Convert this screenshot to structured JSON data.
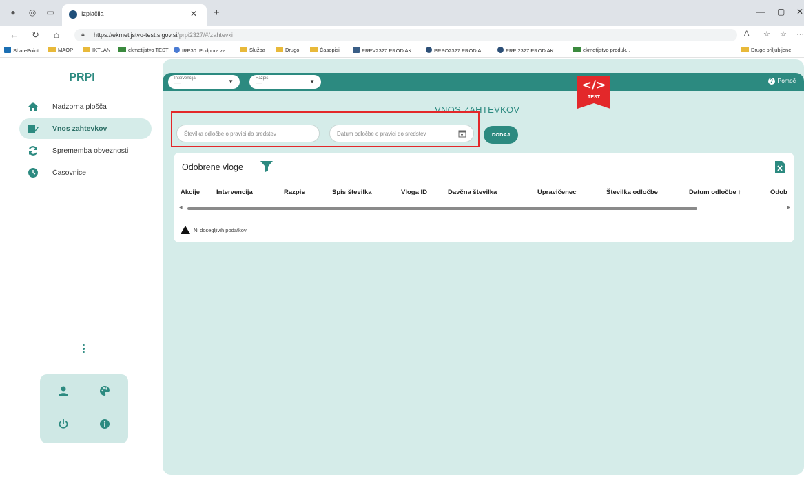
{
  "browser": {
    "tab_title": "Izplačila",
    "url_host": "https://ekmetijstvo-test.sigov.si",
    "url_path": "/prpi2327/#/zahtevki",
    "bookmarks": [
      "SharePoint",
      "MAOP",
      "IXTLAN",
      "ekmetijstvo TEST",
      "IRP30: Podpora za...",
      "Služba",
      "Drugo",
      "Časopisi",
      "PRPV2327 PROD AK...",
      "PRPO2327 PROD A...",
      "PRPI2327 PROD AK...",
      "ekmetijstvo produk..."
    ],
    "other_bookmarks": "Druge priljubljene"
  },
  "sidebar": {
    "brand": "PRPI",
    "items": [
      {
        "label": "Nadzorna plošča",
        "icon": "home-icon"
      },
      {
        "label": "Vnos zahtevkov",
        "icon": "edit-document-icon"
      },
      {
        "label": "Sprememba obveznosti",
        "icon": "refresh-icon"
      },
      {
        "label": "Časovnice",
        "icon": "clock-icon"
      }
    ],
    "utility_icons": [
      "user-icon",
      "palette-icon",
      "power-icon",
      "info-icon"
    ]
  },
  "topbar": {
    "intervencija_label": "Intervencija",
    "razpis_label": "Razpis",
    "help_label": "Pomoč",
    "env_badge": "TEST",
    "env_symbol": "</>"
  },
  "main": {
    "title": "VNOS ZAHTEVKOV",
    "decision_number_placeholder": "Številka odločbe o pravici do sredstev",
    "decision_date_placeholder": "Datum odločbe o pravici do sredstev",
    "add_button": "DODAJ",
    "table": {
      "title": "Odobrene vloge",
      "columns": [
        "Akcije",
        "Intervencija",
        "Razpis",
        "Spis številka",
        "Vloga ID",
        "Davčna številka",
        "Upravičenec",
        "Številka odločbe",
        "Datum odločbe ↑",
        "Odob"
      ],
      "empty_message": "Ni dosegljivih podatkov"
    }
  },
  "colors": {
    "accent": "#2c8a80",
    "accent_light": "#d5ece9",
    "highlight_frame": "#e3282a"
  }
}
